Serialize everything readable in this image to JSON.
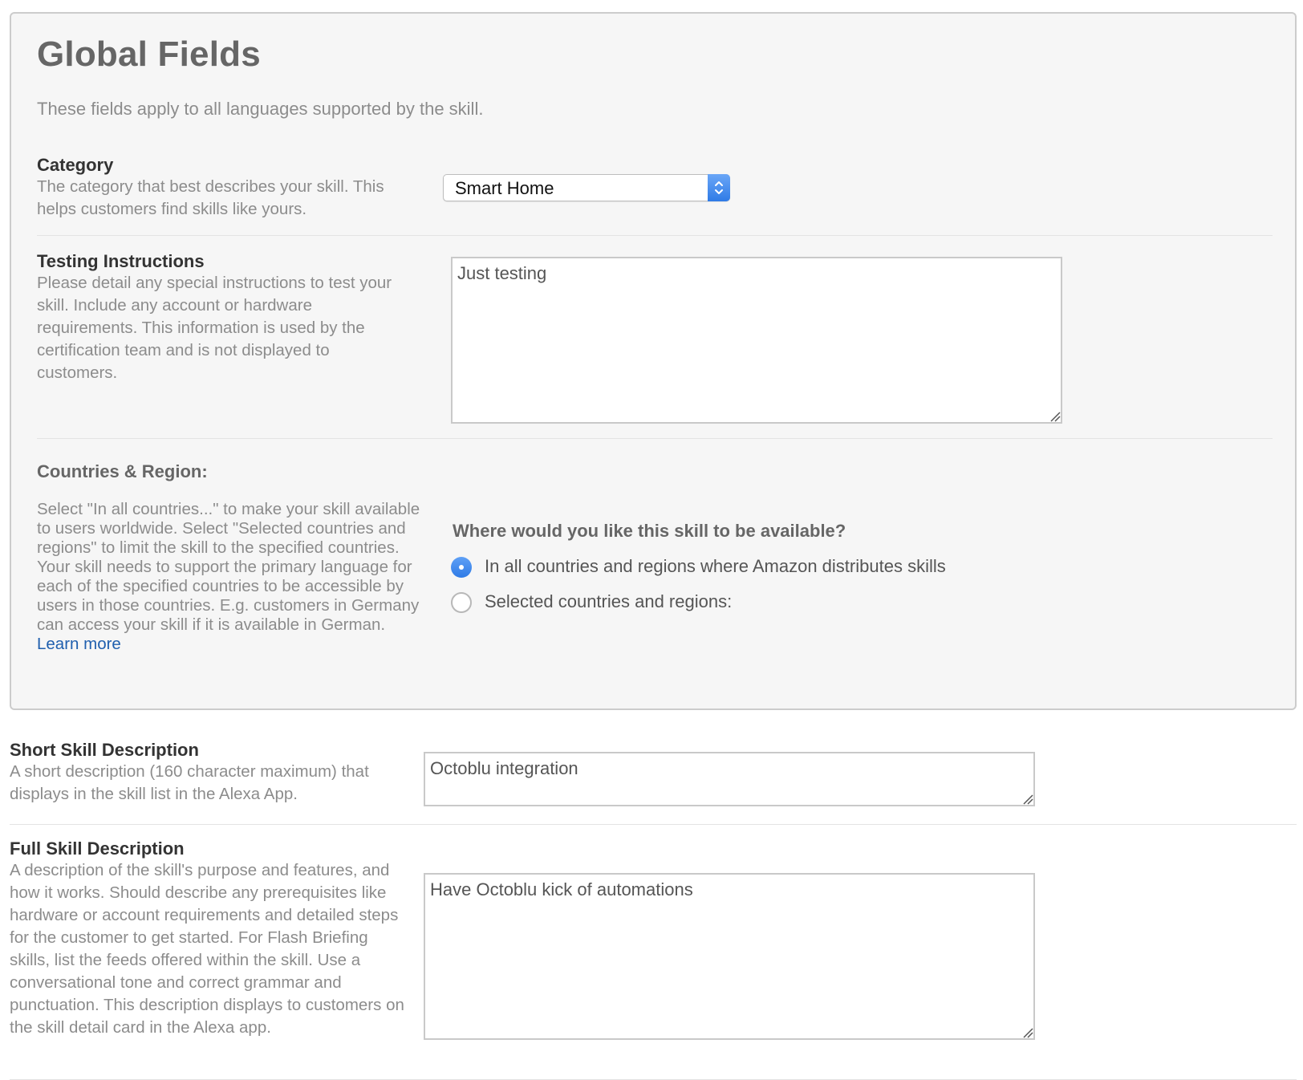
{
  "global_fields": {
    "title": "Global Fields",
    "subtitle": "These fields apply to all languages supported by the skill.",
    "category": {
      "label": "Category",
      "help": "The category that best describes your skill. This helps customers find skills like yours.",
      "selected": "Smart Home"
    },
    "testing_instructions": {
      "label": "Testing Instructions",
      "help": "Please detail any special instructions to test your skill. Include any account or hardware requirements. This information is used by the certification team and is not displayed to customers.",
      "value": "Just testing"
    },
    "countries": {
      "label": "Countries & Region:",
      "help_part1": "Select \"In all countries...\" to make your skill available to users worldwide. Select \"Selected countries and regions\" to limit the skill to the specified countries.",
      "help_part2": "Your skill needs to support the primary language for each of the specified countries to be accessible by users in those countries. E.g. customers in Germany can access your skill if it is available in German.",
      "learn_more": "Learn more",
      "question": "Where would you like this skill to be available?",
      "options": [
        {
          "label": "In all countries and regions where Amazon distributes skills",
          "checked": true
        },
        {
          "label": "Selected countries and regions:",
          "checked": false
        }
      ]
    }
  },
  "short_description": {
    "label": "Short Skill Description",
    "help": "A short description (160 character maximum) that displays in the skill list in the Alexa App.",
    "value": "Octoblu integration"
  },
  "full_description": {
    "label": "Full Skill Description",
    "help": "A description of the skill's purpose and features, and how it works. Should describe any prerequisites like hardware or account requirements and detailed steps for the customer to get started. For Flash Briefing skills, list the feeds offered within the skill. Use a conversational tone and correct grammar and punctuation. This description displays to customers on the skill detail card in the Alexa app.",
    "value": "Have Octoblu kick of automations"
  },
  "colors": {
    "accent": "#2f7be6",
    "link": "#1f5fae",
    "panel_bg": "#f6f6f6"
  }
}
